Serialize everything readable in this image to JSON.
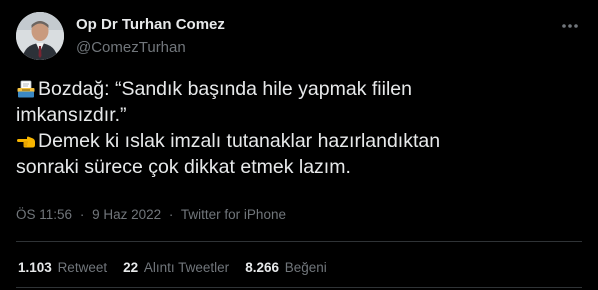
{
  "author": {
    "display_name": "Op Dr Turhan Comez",
    "handle": "@ComezTurhan"
  },
  "tweet": {
    "lines": [
      {
        "icon": "ballot-box-icon",
        "text": "Bozdağ: “Sandık başında hile yapmak fiilen"
      },
      {
        "icon": "",
        "text": "imkansızdır.”"
      },
      {
        "icon": "pointing-hand-icon",
        "text": "Demek ki ıslak imzalı tutanaklar hazırlandıktan"
      },
      {
        "icon": "",
        "text": "sonraki sürece çok dikkat etmek lazım."
      }
    ]
  },
  "meta": {
    "time": "ÖS 11:56",
    "separator": "·",
    "date": "9 Haz 2022",
    "source": "Twitter for iPhone"
  },
  "stats": {
    "retweets_count": "1.103",
    "retweets_label": "Retweet",
    "quotes_count": "22",
    "quotes_label": "Alıntı Tweetler",
    "likes_count": "8.266",
    "likes_label": "Beğeni"
  },
  "colors": {
    "background": "#000000",
    "text_primary": "#e7e9ea",
    "text_secondary": "#71767b",
    "divider": "#2f3336"
  }
}
